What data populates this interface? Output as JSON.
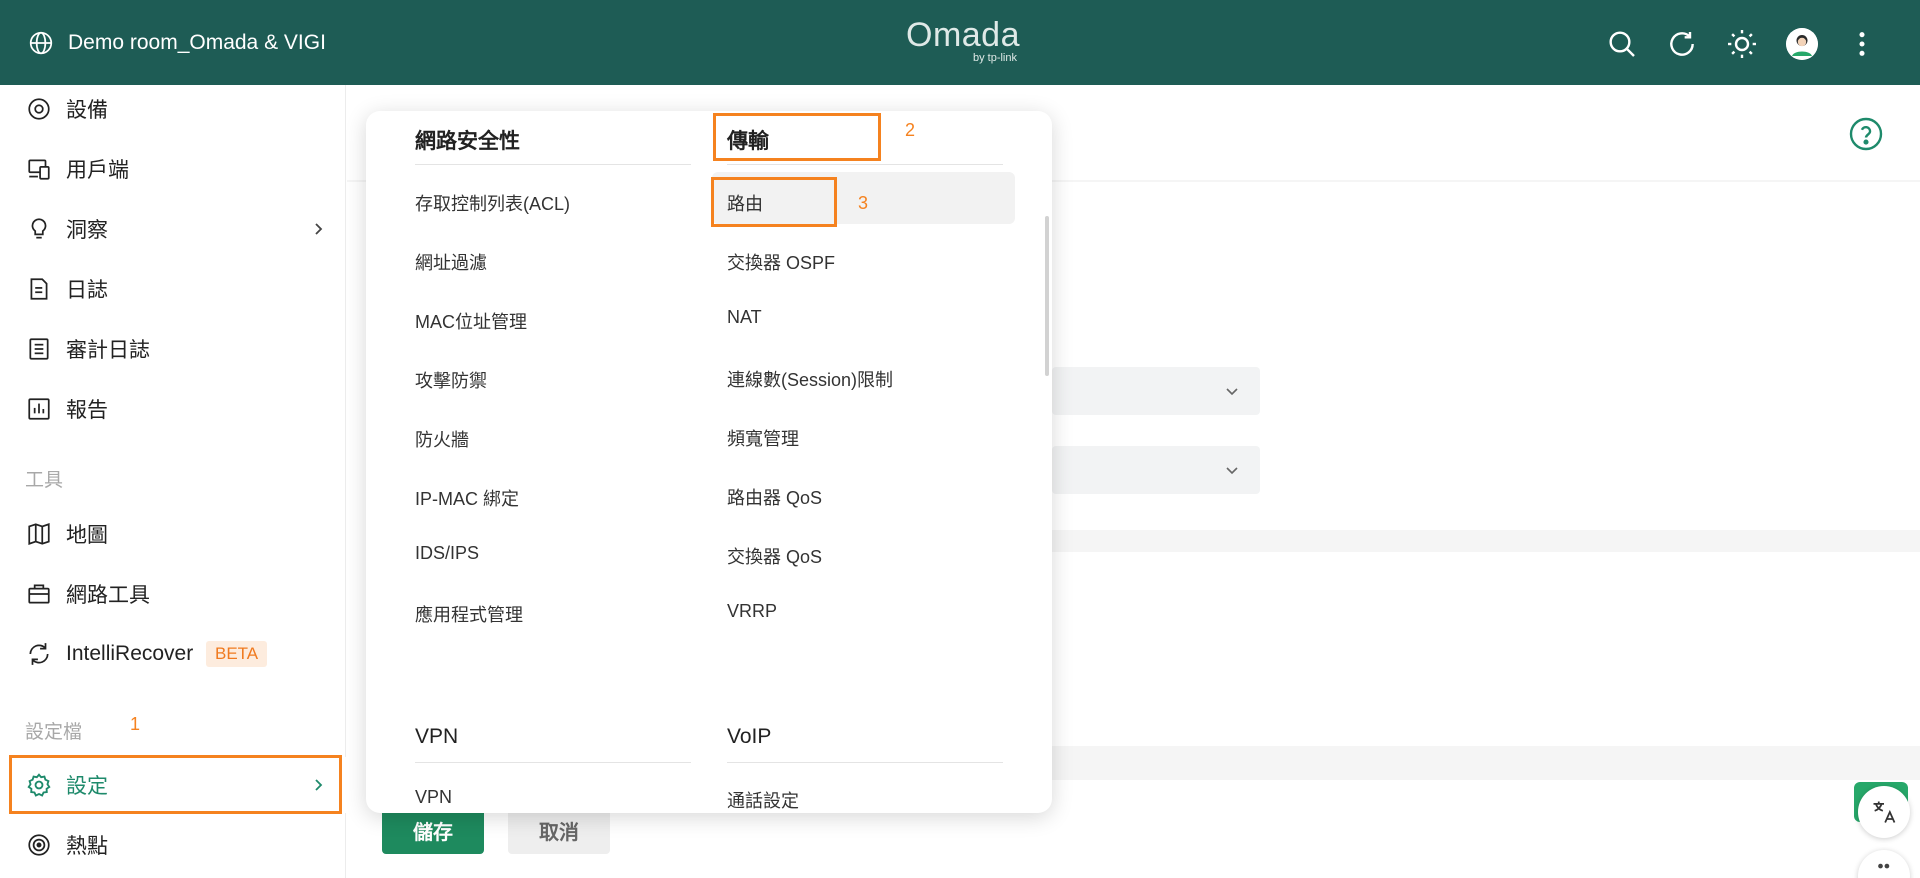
{
  "header": {
    "site_name": "Demo room_Omada & VIGI",
    "logo_text": "Omada",
    "logo_sub": "by tp-link",
    "icons": [
      "search-icon",
      "refresh-icon",
      "theme-sun-icon",
      "user-avatar",
      "more-vertical-icon"
    ]
  },
  "sidebar": {
    "items": [
      {
        "label": "設備",
        "icon": "device-icon"
      },
      {
        "label": "用戶端",
        "icon": "clients-icon"
      },
      {
        "label": "洞察",
        "icon": "insight-bulb-icon",
        "chevron": true
      },
      {
        "label": "日誌",
        "icon": "log-icon"
      },
      {
        "label": "審計日誌",
        "icon": "audit-log-icon"
      },
      {
        "label": "報告",
        "icon": "report-chart-icon"
      }
    ],
    "tools_section": "工具",
    "tool_items": [
      {
        "label": "地圖",
        "icon": "map-icon"
      },
      {
        "label": "網路工具",
        "icon": "network-tools-icon"
      },
      {
        "label": "IntelliRecover",
        "icon": "intellirecover-icon",
        "badge": "BETA"
      }
    ],
    "profile_section": "設定檔",
    "profile_items": [
      {
        "label": "設定",
        "icon": "settings-gear-icon",
        "chevron": true
      },
      {
        "label": "熱點",
        "icon": "hotspot-icon"
      }
    ]
  },
  "annotations": [
    "1",
    "2",
    "3"
  ],
  "menu": {
    "col1_heading": "網路安全性",
    "col1_items": [
      "存取控制列表(ACL)",
      "網址過濾",
      "MAC位址管理",
      "攻擊防禦",
      "防火牆",
      "IP-MAC 綁定",
      "IDS/IPS",
      "應用程式管理"
    ],
    "col2_heading": "傳輸",
    "col2_items": [
      "路由",
      "交換器 OSPF",
      "NAT",
      "連線數(Session)限制",
      "頻寬管理",
      "路由器 QoS",
      "交換器 QoS",
      "VRRP"
    ],
    "col3_heading": "VPN",
    "col3_items": [
      "VPN"
    ],
    "col4_heading": "VoIP",
    "col4_items": [
      "通話設定"
    ]
  },
  "actions": {
    "save": "儲存",
    "cancel": "取消"
  },
  "colors": {
    "header_bg": "#1e5c55",
    "accent_green": "#1e8a5e",
    "annotation_orange": "#f5821f"
  }
}
